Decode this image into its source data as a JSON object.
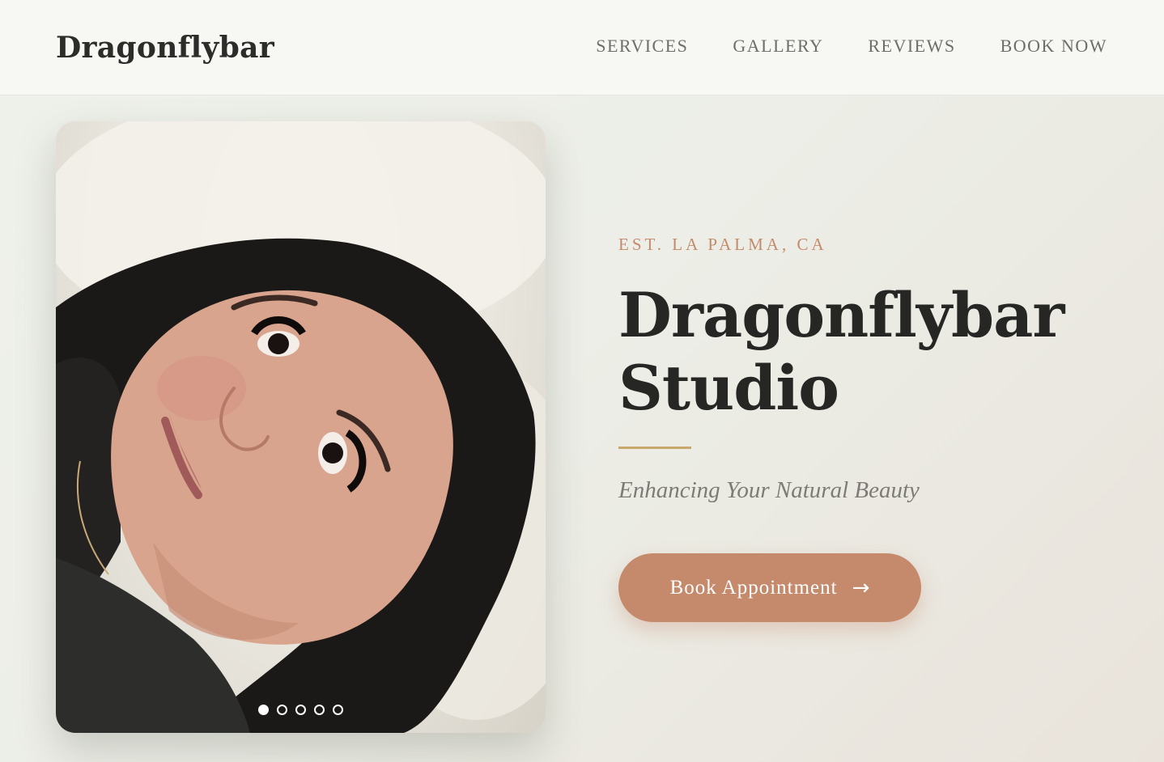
{
  "header": {
    "logo": "Dragonflybar",
    "nav": [
      {
        "label": "SERVICES"
      },
      {
        "label": "GALLERY"
      },
      {
        "label": "REVIEWS"
      },
      {
        "label": "BOOK NOW"
      }
    ]
  },
  "hero": {
    "eyebrow": "EST. LA PALMA, CA",
    "title_line1": "Dragonflybar",
    "title_line2": "Studio",
    "tagline": "Enhancing Your Natural Beauty",
    "cta_label": "Book Appointment",
    "cta_icon": "arrow-right-icon",
    "cta_glyph": "→"
  },
  "carousel": {
    "slide_count": 5,
    "active_index": 0,
    "photo": "portrait-lash-extensions-image"
  },
  "colors": {
    "accent": "#c58a6c",
    "eyebrow": "#c48a6b",
    "rule": "#c9a86d",
    "text_dark": "#262624"
  }
}
